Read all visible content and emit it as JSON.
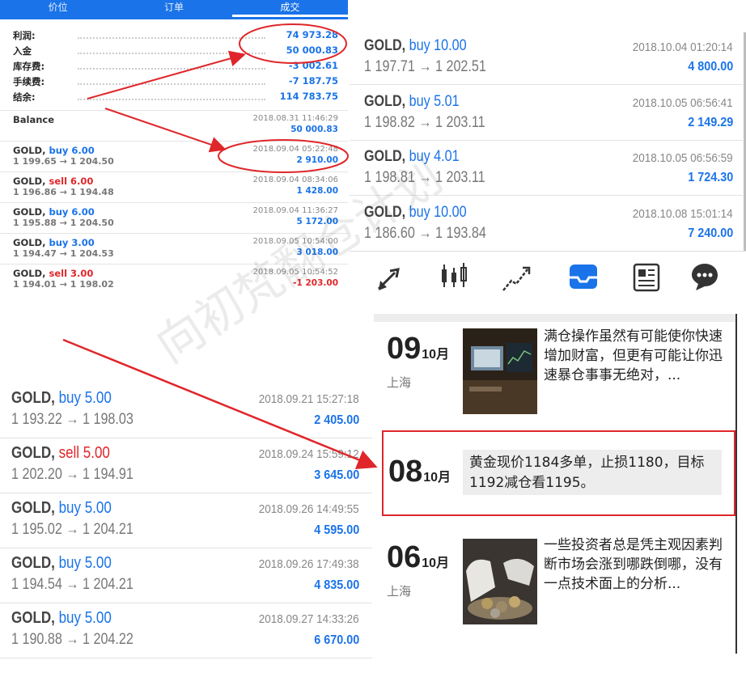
{
  "top_left": {
    "tabs": [
      "价位",
      "订单",
      "成交"
    ],
    "summary": [
      {
        "label": "利润:",
        "value": "74 973.28"
      },
      {
        "label": "入金",
        "value": "50 000.83"
      },
      {
        "label": "库存费:",
        "value": "-3 002.61"
      },
      {
        "label": "手续费:",
        "value": "-7 187.75"
      },
      {
        "label": "结余:",
        "value": "114 783.75"
      }
    ],
    "balance": {
      "label": "Balance",
      "time": "2018.08.31 11:46:29",
      "amount": "50 000.83"
    },
    "trades": [
      {
        "symbol": "GOLD,",
        "type": "buy 6.00",
        "prices": "1 199.65 → 1 204.50",
        "time": "2018.09.04 05:22:48",
        "profit": "2 910.00"
      },
      {
        "symbol": "GOLD,",
        "type": "sell 6.00",
        "prices": "1 196.86 → 1 194.48",
        "time": "2018.09.04 08:34:06",
        "profit": "1 428.00"
      },
      {
        "symbol": "GOLD,",
        "type": "buy 6.00",
        "prices": "1 195.88 → 1 204.50",
        "time": "2018.09.04 11:36:27",
        "profit": "5 172.00"
      },
      {
        "symbol": "GOLD,",
        "type": "buy 3.00",
        "prices": "1 194.47 → 1 204.53",
        "time": "2018.09.05 10:54:00",
        "profit": "3 018.00"
      },
      {
        "symbol": "GOLD,",
        "type": "sell 3.00",
        "prices": "1 194.01 → 1 198.02",
        "time": "2018.09.05 10:54:52",
        "profit": "-1 203.00"
      }
    ]
  },
  "top_right": {
    "trades": [
      {
        "symbol": "GOLD,",
        "type": "buy 10.00",
        "prices": "1 197.71 → 1 202.51",
        "time": "2018.10.04 01:20:14",
        "profit": "4 800.00"
      },
      {
        "symbol": "GOLD,",
        "type": "buy 5.01",
        "prices": "1 198.82 → 1 203.11",
        "time": "2018.10.05 06:56:41",
        "profit": "2 149.29"
      },
      {
        "symbol": "GOLD,",
        "type": "buy 4.01",
        "prices": "1 198.81 → 1 203.11",
        "time": "2018.10.05 06:56:59",
        "profit": "1 724.30"
      },
      {
        "symbol": "GOLD,",
        "type": "buy 10.00",
        "prices": "1 186.60 → 1 193.84",
        "time": "2018.10.08 15:01:14",
        "profit": "7 240.00"
      }
    ],
    "toolbar_icons": [
      "trade-icon",
      "candlestick-chart-icon",
      "trend-chart-icon",
      "history-inbox-icon",
      "news-icon",
      "chat-icon"
    ]
  },
  "bottom_left": {
    "trades": [
      {
        "symbol": "GOLD,",
        "type": "buy 5.00",
        "prices": "1 193.22 → 1 198.03",
        "time": "2018.09.21 15:27:18",
        "profit": "2 405.00"
      },
      {
        "symbol": "GOLD,",
        "type": "sell 5.00",
        "prices": "1 202.20 → 1 194.91",
        "time": "2018.09.24 15:59:12",
        "profit": "3 645.00"
      },
      {
        "symbol": "GOLD,",
        "type": "buy 5.00",
        "prices": "1 195.02 → 1 204.21",
        "time": "2018.09.26 14:49:55",
        "profit": "4 595.00"
      },
      {
        "symbol": "GOLD,",
        "type": "buy 5.00",
        "prices": "1 194.54 → 1 204.21",
        "time": "2018.09.26 17:49:38",
        "profit": "4 835.00"
      },
      {
        "symbol": "GOLD,",
        "type": "buy 5.00",
        "prices": "1 190.88 → 1 204.22",
        "time": "2018.09.27 14:33:26",
        "profit": "6 670.00"
      }
    ]
  },
  "news": [
    {
      "day": "09",
      "month": "10月",
      "city": "上海",
      "text": "满仓操作虽然有可能使你快速增加财富，但更有可能让你迅速暴仓事事无绝对，..."
    },
    {
      "day": "08",
      "month": "10月",
      "city": "",
      "text": "黄金现价1184多单，止损1180，目标1192减仓看1195。"
    },
    {
      "day": "06",
      "month": "10月",
      "city": "上海",
      "text": "一些投资者总是凭主观因素判断市场会涨到哪跌倒哪，没有一点技术面上的分析..."
    }
  ],
  "watermark": "向初梵翻仓计划",
  "colors": {
    "accent": "#1a73e8",
    "sell": "#e0262a",
    "annotation": "#e0262a"
  }
}
